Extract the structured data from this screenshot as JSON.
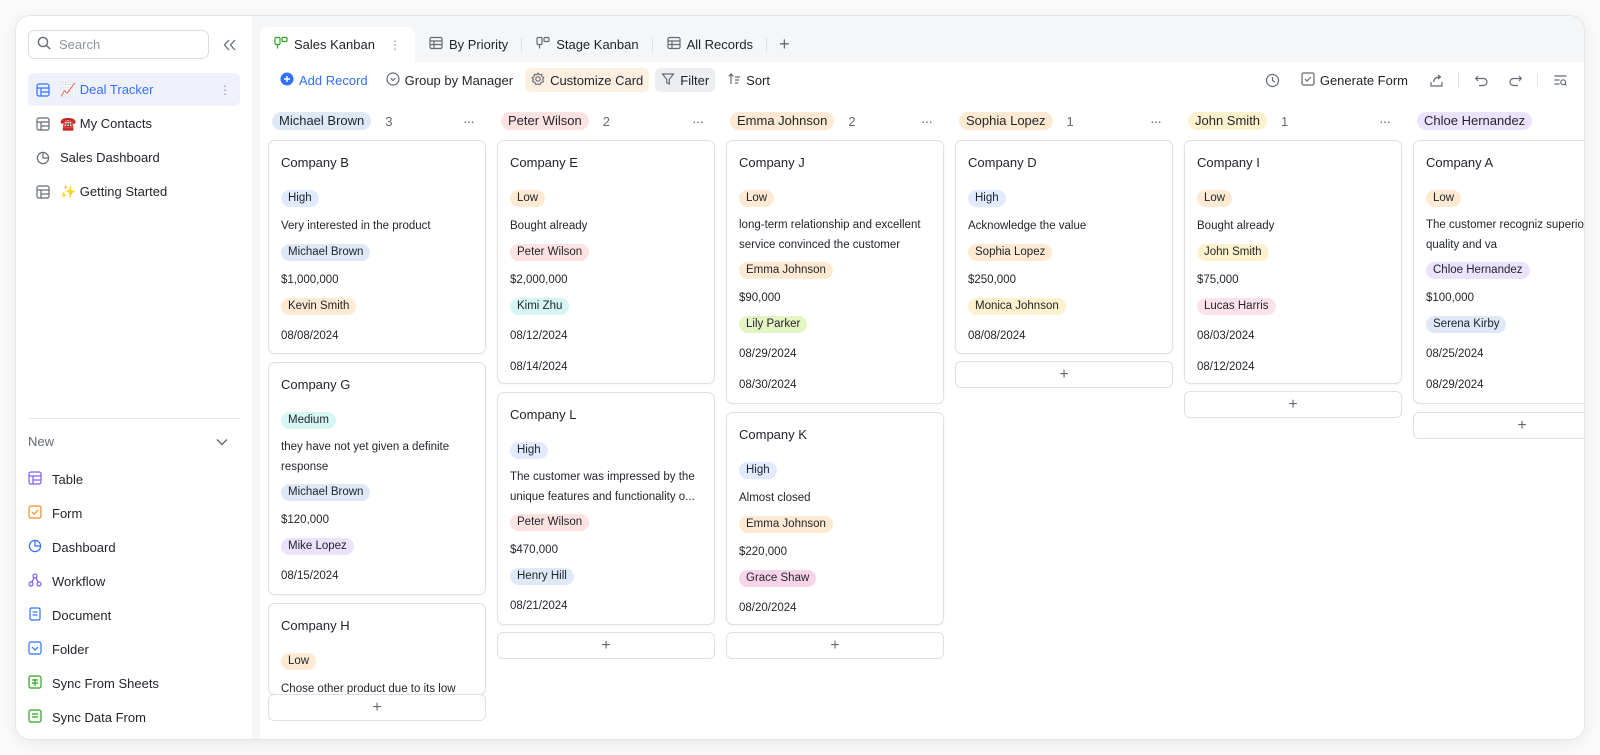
{
  "sidebar": {
    "search_placeholder": "Search",
    "items": [
      {
        "label": "📈 Deal Tracker"
      },
      {
        "label": "☎️ My Contacts"
      },
      {
        "label": "Sales Dashboard"
      },
      {
        "label": "✨ Getting Started"
      }
    ],
    "new_label": "New",
    "new_items": [
      {
        "label": "Table"
      },
      {
        "label": "Form"
      },
      {
        "label": "Dashboard"
      },
      {
        "label": "Workflow"
      },
      {
        "label": "Document"
      },
      {
        "label": "Folder"
      },
      {
        "label": "Sync From Sheets"
      },
      {
        "label": "Sync Data From"
      }
    ]
  },
  "tabs": [
    {
      "label": "Sales Kanban"
    },
    {
      "label": "By Priority"
    },
    {
      "label": "Stage Kanban"
    },
    {
      "label": "All Records"
    }
  ],
  "toolbar": {
    "add_record": "Add Record",
    "group_by": "Group by Manager",
    "customize_card": "Customize Card",
    "filter": "Filter",
    "sort": "Sort",
    "generate_form": "Generate Form"
  },
  "columns": [
    {
      "name": "Michael Brown",
      "count": "3",
      "cards": [
        {
          "title": "Company B",
          "priority": "High",
          "note": "Very interested in the product",
          "manager": "Michael Brown",
          "amount": "$1,000,000",
          "contact": "Kevin Smith",
          "date1": "08/08/2024",
          "date2": ""
        },
        {
          "title": "Company G",
          "priority": "Medium",
          "note": "they have not yet given a definite response",
          "manager": "Michael Brown",
          "amount": "$120,000",
          "contact": "Mike Lopez",
          "date1": "08/15/2024",
          "date2": ""
        },
        {
          "title": "Company H",
          "priority": "Low",
          "note": "Chose other product due to its low",
          "manager": "",
          "amount": "",
          "contact": "",
          "date1": "",
          "date2": ""
        }
      ]
    },
    {
      "name": "Peter Wilson",
      "count": "2",
      "cards": [
        {
          "title": "Company E",
          "priority": "Low",
          "note": "Bought already",
          "manager": "Peter Wilson",
          "amount": "$2,000,000",
          "contact": "Kimi Zhu",
          "date1": "08/12/2024",
          "date2": "08/14/2024"
        },
        {
          "title": "Company L",
          "priority": "High",
          "note": "The customer was impressed by the unique features and functionality o...",
          "manager": "Peter Wilson",
          "amount": "$470,000",
          "contact": "Henry Hill",
          "date1": "08/21/2024",
          "date2": ""
        }
      ]
    },
    {
      "name": "Emma Johnson",
      "count": "2",
      "cards": [
        {
          "title": "Company J",
          "priority": "Low",
          "note": "long-term relationship and excellent service convinced the customer",
          "manager": "Emma Johnson",
          "amount": "$90,000",
          "contact": "Lily Parker",
          "date1": "08/29/2024",
          "date2": "08/30/2024"
        },
        {
          "title": "Company K",
          "priority": "High",
          "note": "Almost closed",
          "manager": "Emma Johnson",
          "amount": "$220,000",
          "contact": "Grace Shaw",
          "date1": "08/20/2024",
          "date2": ""
        }
      ]
    },
    {
      "name": "Sophia Lopez",
      "count": "1",
      "cards": [
        {
          "title": "Company D",
          "priority": "High",
          "note": "Acknowledge the value",
          "manager": "Sophia Lopez",
          "amount": "$250,000",
          "contact": "Monica Johnson",
          "date1": "08/08/2024",
          "date2": ""
        }
      ]
    },
    {
      "name": "John Smith",
      "count": "1",
      "cards": [
        {
          "title": "Company I",
          "priority": "Low",
          "note": "Bought already",
          "manager": "John Smith",
          "amount": "$75,000",
          "contact": "Lucas Harris",
          "date1": "08/03/2024",
          "date2": "08/12/2024"
        }
      ]
    },
    {
      "name": "Chloe Hernandez",
      "count": "",
      "cards": [
        {
          "title": "Company A",
          "priority": "Low",
          "note": "The customer recogniz superior quality and va",
          "manager": "Chloe Hernandez",
          "amount": "$100,000",
          "contact": "Serena Kirby",
          "date1": "08/25/2024",
          "date2": "08/29/2024"
        }
      ]
    }
  ],
  "colors": {
    "accent": "#3370ff",
    "priority_high": "#e1eaff",
    "priority_medium": "#d5f6f2",
    "priority_low": "#feead2"
  }
}
